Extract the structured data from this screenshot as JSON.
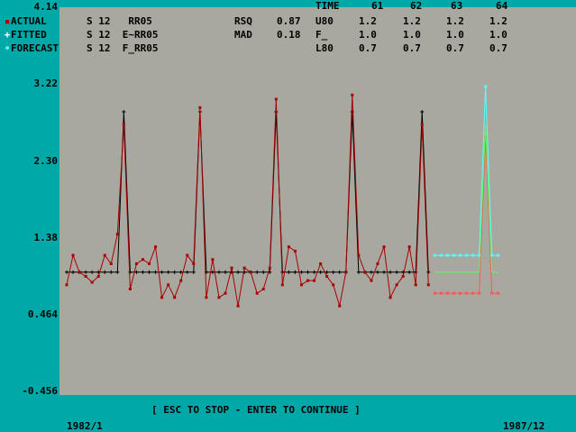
{
  "header": {
    "legend": [
      {
        "marker": "▪",
        "label": "ACTUAL",
        "color": "#a80000",
        "model": "S 12   RR05"
      },
      {
        "marker": "+",
        "label": "FITTED",
        "color": "#ffffff",
        "model": "S 12  E~RR05"
      },
      {
        "marker": "∙",
        "label": "FORECAST",
        "color": "#55ffff",
        "model": "S 12  F_RR05"
      }
    ],
    "stats": [
      {
        "label": "RSQ",
        "value": "0.87"
      },
      {
        "label": "MAD",
        "value": "0.18"
      }
    ],
    "time_label": "TIME",
    "time_cols": [
      "61",
      "62",
      "63",
      "64"
    ],
    "rows": [
      {
        "label": "U80",
        "values": [
          "1.2",
          "1.2",
          "1.2",
          "1.2"
        ]
      },
      {
        "label": "F_",
        "values": [
          "1.0",
          "1.0",
          "1.0",
          "1.0"
        ]
      },
      {
        "label": "L80",
        "values": [
          "0.7",
          "0.7",
          "0.7",
          "0.7"
        ]
      }
    ]
  },
  "footer": {
    "prompt": "[ ESC TO STOP - ENTER TO CONTINUE ]",
    "x_start": "1982/1",
    "x_end": "1987/12"
  },
  "chart_data": {
    "type": "line",
    "y_ticks": [
      "4.14",
      "3.22",
      "2.30",
      "1.38",
      "0.464",
      "-0.456"
    ],
    "ylim": [
      -0.456,
      4.14
    ],
    "x_range": [
      "1982/1",
      "1987/12"
    ],
    "colors": {
      "actual": "#a80000",
      "fitted": "#000000",
      "forecast": "#55ffff",
      "upper": "#55ffff",
      "mid": "#55ff55",
      "lower": "#ff5555"
    },
    "actual": [
      0.85,
      1.2,
      1.0,
      0.95,
      0.88,
      0.95,
      1.2,
      1.1,
      1.45,
      2.75,
      0.8,
      1.1,
      1.15,
      1.1,
      1.3,
      0.7,
      0.85,
      0.7,
      0.9,
      1.2,
      1.1,
      2.95,
      0.7,
      1.15,
      0.7,
      0.75,
      1.05,
      0.6,
      1.05,
      1.0,
      0.75,
      0.8,
      1.05,
      3.05,
      0.85,
      1.3,
      1.25,
      0.85,
      0.9,
      0.9,
      1.1,
      0.95,
      0.85,
      0.6,
      1.0,
      3.1,
      1.2,
      1.0,
      0.9,
      1.1,
      1.3,
      0.7,
      0.85,
      0.95,
      1.3,
      0.85,
      2.75,
      0.85
    ],
    "fitted": [
      1.0,
      1.0,
      1.0,
      1.0,
      1.0,
      1.0,
      1.0,
      1.0,
      1.0,
      2.9,
      1.0,
      1.0,
      1.0,
      1.0,
      1.0,
      1.0,
      1.0,
      1.0,
      1.0,
      1.0,
      1.0,
      2.9,
      1.0,
      1.0,
      1.0,
      1.0,
      1.0,
      1.0,
      1.0,
      1.0,
      1.0,
      1.0,
      1.0,
      2.9,
      1.0,
      1.0,
      1.0,
      1.0,
      1.0,
      1.0,
      1.0,
      1.0,
      1.0,
      1.0,
      1.0,
      2.9,
      1.0,
      1.0,
      1.0,
      1.0,
      1.0,
      1.0,
      1.0,
      1.0,
      1.0,
      1.0,
      2.9,
      1.0
    ],
    "forecast_upper": [
      1.2,
      1.2,
      1.2,
      1.2,
      1.2,
      1.2,
      1.2,
      1.2,
      3.2,
      1.2,
      1.2
    ],
    "forecast_mid": [
      1.0,
      1.0,
      1.0,
      1.0,
      1.0,
      1.0,
      1.0,
      1.0,
      2.75,
      1.0,
      1.0
    ],
    "forecast_lower": [
      0.75,
      0.75,
      0.75,
      0.75,
      0.75,
      0.75,
      0.75,
      0.75,
      2.6,
      0.75,
      0.75
    ]
  }
}
